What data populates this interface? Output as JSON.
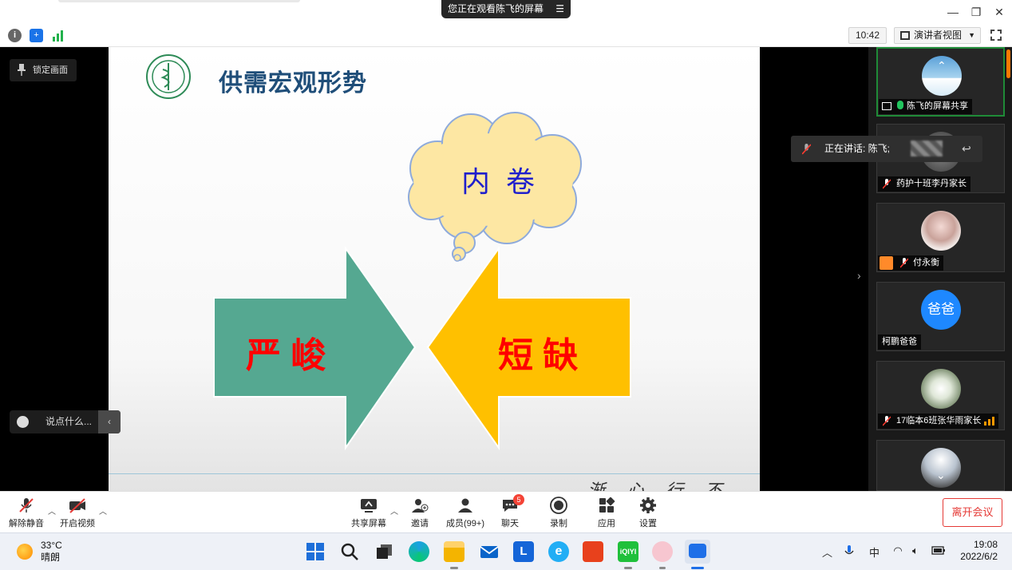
{
  "window": {
    "sharing_banner": "您正在观看陈飞的屏幕",
    "controls": [
      "minimize-icon",
      "restore-icon",
      "close-icon"
    ]
  },
  "toolbar": {
    "meeting_time": "10:42",
    "view_mode": "演讲者视图"
  },
  "slide": {
    "title": "供需宏观形势",
    "cloud_text": "内  卷",
    "left_arrow_text": "严 峻",
    "right_arrow_text": "短 缺",
    "footer_script": "渐 心 行 不 贵",
    "colors": {
      "title": "#1f4e79",
      "left_arrow": "#55a891",
      "right_arrow": "#ffc000",
      "arrow_text": "#ff0000",
      "cloud_fill": "#fde7a3",
      "cloud_text": "#1f1fcc"
    }
  },
  "overlay": {
    "lock_screen": "锁定画面",
    "chat_placeholder": "说点什么..."
  },
  "participants": [
    {
      "name": "陈飞的屏幕共享",
      "active": true
    },
    {
      "name": "药护十班李丹家长",
      "muted": true
    },
    {
      "name": "付永衡",
      "muted": true
    },
    {
      "name": "柯鹏爸爸",
      "avatar_text": "爸爸"
    },
    {
      "name": "17临本6班张华雨家长",
      "muted": true
    },
    {
      "name": ""
    }
  ],
  "speaking": {
    "label": "正在讲话: 陈飞;"
  },
  "bottom_bar": {
    "unmute": "解除静音",
    "start_video": "开启视频",
    "share_screen": "共享屏幕",
    "invite": "邀请",
    "members": "成员(99+)",
    "chat": "聊天",
    "chat_badge": "5",
    "record": "录制",
    "apps": "应用",
    "settings": "设置",
    "leave": "离开会议"
  },
  "taskbar": {
    "temperature": "33°C",
    "weather": "晴朗",
    "ime": "中",
    "time": "19:08",
    "date": "2022/6/2"
  }
}
